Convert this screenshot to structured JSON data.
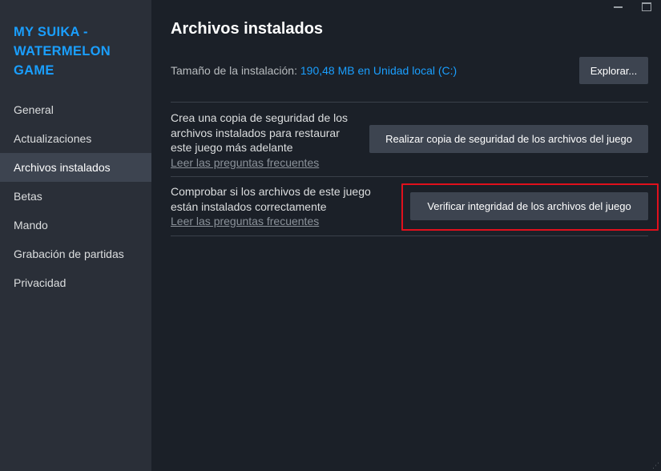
{
  "sidebar": {
    "game_title": "MY SUIKA - WATERMELON GAME",
    "items": [
      {
        "label": "General"
      },
      {
        "label": "Actualizaciones"
      },
      {
        "label": "Archivos instalados",
        "active": true
      },
      {
        "label": "Betas"
      },
      {
        "label": "Mando"
      },
      {
        "label": "Grabación de partidas"
      },
      {
        "label": "Privacidad"
      }
    ]
  },
  "window": {
    "minimize_icon": "minimize-icon",
    "maximize_icon": "maximize-icon"
  },
  "main": {
    "title": "Archivos instalados",
    "size_label": "Tamaño de la instalación: ",
    "size_value": "190,48 MB en Unidad local (C:)",
    "explore_button": "Explorar...",
    "backup": {
      "description": "Crea una copia de seguridad de los archivos instalados para restaurar este juego más adelante",
      "faq_link": "Leer las preguntas frecuentes",
      "button": "Realizar copia de seguridad de los archivos del juego"
    },
    "verify": {
      "description": "Comprobar si los archivos de este juego están instalados correctamente",
      "faq_link": "Leer las preguntas frecuentes",
      "button": "Verificar integridad de los archivos del juego"
    }
  },
  "colors": {
    "accent": "#1a9fff",
    "highlight": "#e0101c",
    "sidebar_bg": "#2a2f38",
    "main_bg": "#1b2028"
  }
}
